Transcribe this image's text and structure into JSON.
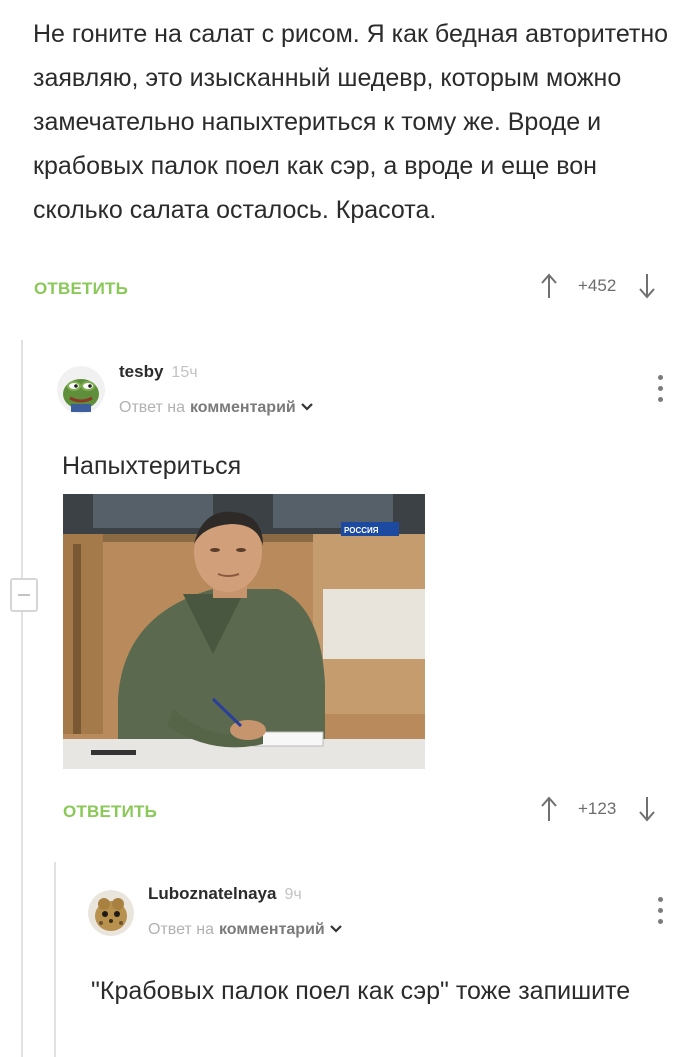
{
  "top_comment": {
    "text": "Не гоните на салат с рисом. Я как бедная авторитетно заявляю, это изысканный шедевр, которым можно замечательно напыхтериться к тому же. Вроде и крабовых палок поел как сэр, а вроде и еще вон сколько салата осталось. Красота.",
    "reply_label": "ОТВЕТИТЬ",
    "rating": "+452"
  },
  "comment_1": {
    "username": "tesby",
    "time": "15ч",
    "reply_to_prefix": "Ответ на",
    "reply_to_link": "комментарий",
    "text": "Напыхтериться",
    "image_logo": "РОССИЯ",
    "reply_label": "ОТВЕТИТЬ",
    "rating": "+123"
  },
  "comment_2": {
    "username": "Luboznatelnaya",
    "time": "9ч",
    "reply_to_prefix": "Ответ на",
    "reply_to_link": "комментарий",
    "text": "\"Крабовых палок поел как сэр\" тоже запишите"
  },
  "colors": {
    "accent_green": "#8ac858",
    "thread_line": "#e1e1e1",
    "muted_text": "#b1b1b1"
  },
  "icons": [
    "arrow-up-icon",
    "arrow-down-icon",
    "kebab-menu-icon",
    "chevron-down-icon",
    "collapse-minus-icon"
  ]
}
